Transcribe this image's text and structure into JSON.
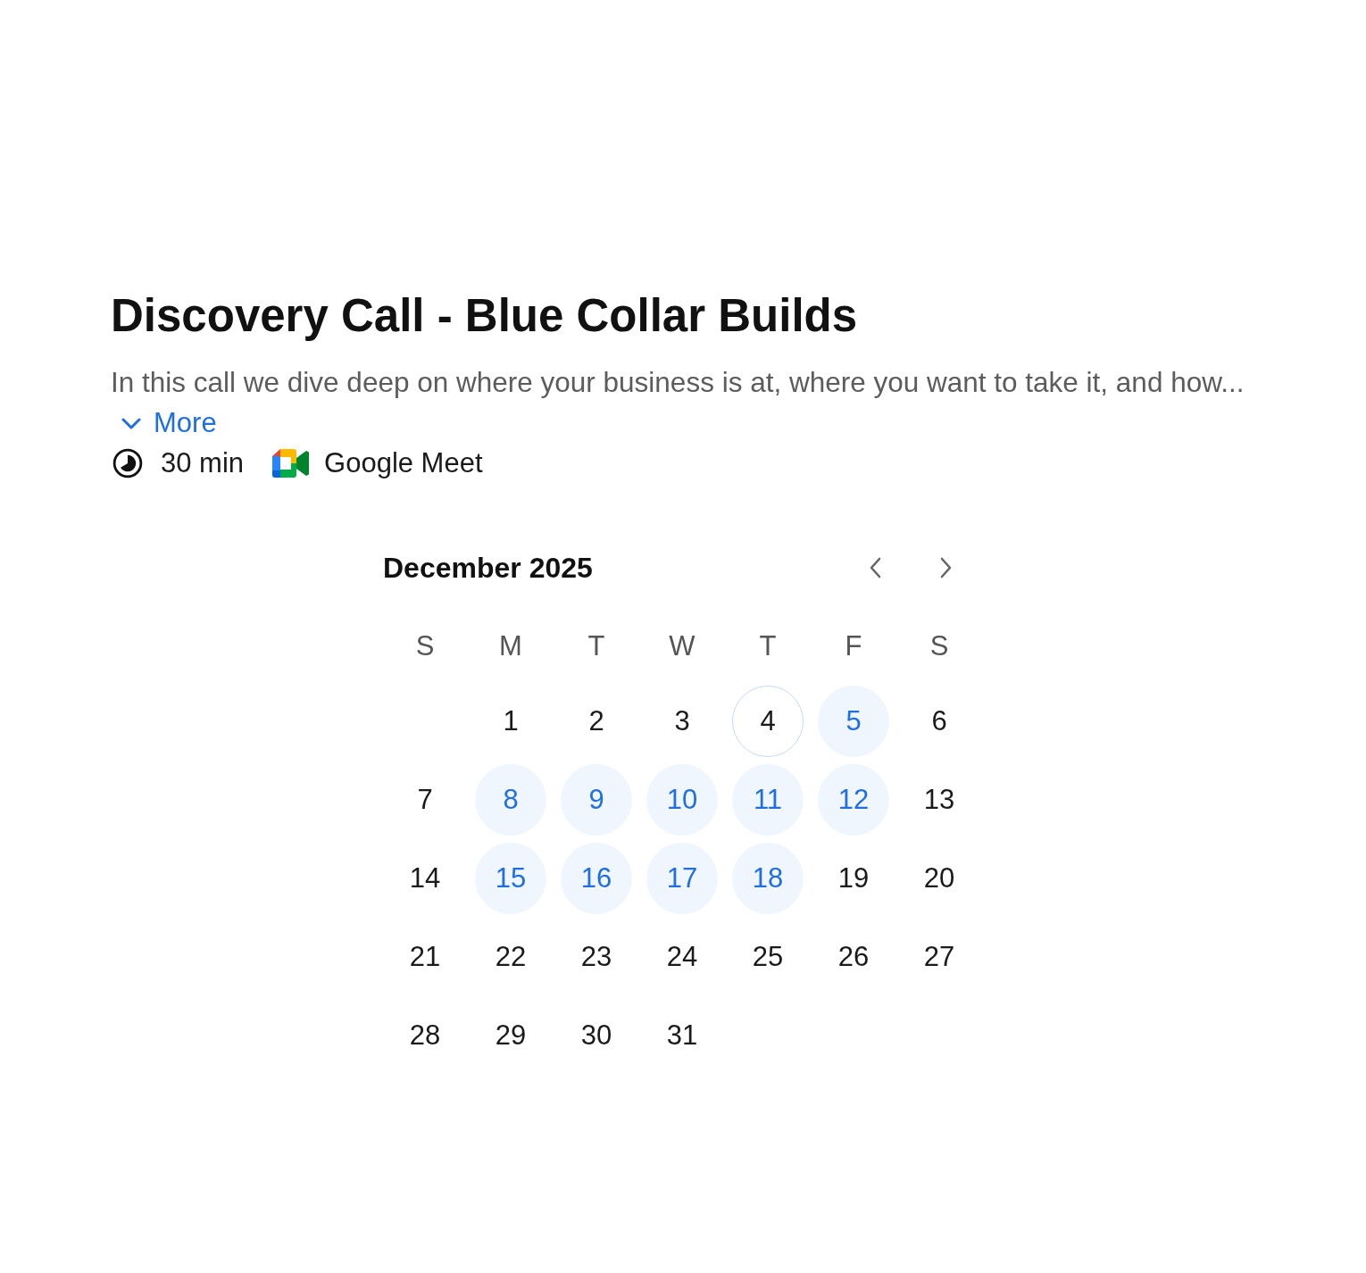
{
  "event": {
    "title": "Discovery Call - Blue Collar Builds",
    "description": "In this call we dive deep on where your business is at, where you want to take it, and how...",
    "more_link": "More",
    "details": [
      {
        "kind": "duration",
        "label": "30 min"
      },
      {
        "kind": "video",
        "label": "Google Meet"
      }
    ]
  },
  "calendar": {
    "month": "December 2025",
    "weekdays": [
      "S",
      "M",
      "T",
      "W",
      "T",
      "F",
      "S"
    ],
    "weeks": [
      {
        "kind": "leading",
        "days": [
          {
            "label": "1",
            "available": false,
            "today": false
          },
          {
            "label": "2",
            "available": false,
            "today": false
          },
          {
            "label": "3",
            "available": false,
            "today": false
          },
          {
            "label": "4",
            "available": false,
            "today": true
          },
          {
            "label": "5",
            "available": true,
            "today": false
          },
          {
            "label": "6",
            "available": false,
            "today": false
          }
        ]
      },
      {
        "kind": "full",
        "days": [
          {
            "label": "7",
            "available": false,
            "today": false
          },
          {
            "label": "8",
            "available": true,
            "today": false
          },
          {
            "label": "9",
            "available": true,
            "today": false
          },
          {
            "label": "10",
            "available": true,
            "today": false
          },
          {
            "label": "11",
            "available": true,
            "today": false
          },
          {
            "label": "12",
            "available": true,
            "today": false
          },
          {
            "label": "13",
            "available": false,
            "today": false
          }
        ]
      },
      {
        "kind": "full",
        "days": [
          {
            "label": "14",
            "available": false,
            "today": false
          },
          {
            "label": "15",
            "available": true,
            "today": false
          },
          {
            "label": "16",
            "available": true,
            "today": false
          },
          {
            "label": "17",
            "available": true,
            "today": false
          },
          {
            "label": "18",
            "available": true,
            "today": false
          },
          {
            "label": "19",
            "available": false,
            "today": false
          },
          {
            "label": "20",
            "available": false,
            "today": false
          }
        ]
      },
      {
        "kind": "full",
        "days": [
          {
            "label": "21",
            "available": false,
            "today": false
          },
          {
            "label": "22",
            "available": false,
            "today": false
          },
          {
            "label": "23",
            "available": false,
            "today": false
          },
          {
            "label": "24",
            "available": false,
            "today": false
          },
          {
            "label": "25",
            "available": false,
            "today": false
          },
          {
            "label": "26",
            "available": false,
            "today": false
          },
          {
            "label": "27",
            "available": false,
            "today": false
          }
        ]
      },
      {
        "kind": "trailing",
        "days": [
          {
            "label": "28",
            "available": false,
            "today": false
          },
          {
            "label": "29",
            "available": false,
            "today": false
          },
          {
            "label": "30",
            "available": false,
            "today": false
          },
          {
            "label": "31",
            "available": false,
            "today": false
          }
        ]
      }
    ]
  }
}
